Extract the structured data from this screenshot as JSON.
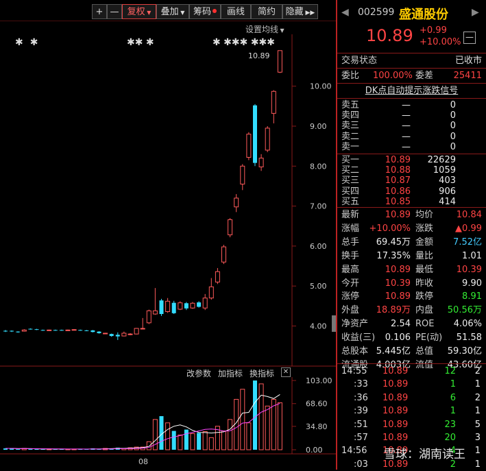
{
  "toolbar": {
    "plus": "+",
    "minus": "—",
    "fuquan": "复权",
    "diejia": "叠加",
    "chouma": "筹码",
    "huaxian": "画线",
    "jianyue": "简约",
    "yincang": "隐藏"
  },
  "chart": {
    "set_ma": "设置均线",
    "high_label": "10.89",
    "y_ticks": [
      "10.00",
      "9.00",
      "8.00",
      "7.00",
      "6.00",
      "5.00",
      "4.00"
    ],
    "date_label": "08",
    "indicator_buttons": [
      "改参数",
      "加指标",
      "换指标"
    ],
    "vol_ticks": [
      "103.00",
      "68.60",
      "34.80",
      "0.00"
    ]
  },
  "chart_data": {
    "type": "candlestick",
    "price_ticks": [
      10,
      9,
      8,
      7,
      6,
      5,
      4
    ],
    "candles": [
      {
        "o": 3.88,
        "c": 3.87,
        "h": 3.9,
        "l": 3.85
      },
      {
        "o": 3.88,
        "c": 3.87,
        "h": 3.89,
        "l": 3.85
      },
      {
        "o": 3.86,
        "c": 3.85,
        "h": 3.87,
        "l": 3.83
      },
      {
        "o": 3.87,
        "c": 3.9,
        "h": 3.92,
        "l": 3.86
      },
      {
        "o": 3.93,
        "c": 3.92,
        "h": 3.94,
        "l": 3.91
      },
      {
        "o": 3.92,
        "c": 3.91,
        "h": 3.93,
        "l": 3.9
      },
      {
        "o": 3.9,
        "c": 3.89,
        "h": 3.91,
        "l": 3.88
      },
      {
        "o": 3.89,
        "c": 3.9,
        "h": 3.91,
        "l": 3.88
      },
      {
        "o": 3.9,
        "c": 3.89,
        "h": 3.91,
        "l": 3.88
      },
      {
        "o": 3.9,
        "c": 3.89,
        "h": 3.91,
        "l": 3.88
      },
      {
        "o": 3.89,
        "c": 3.9,
        "h": 3.91,
        "l": 3.88
      },
      {
        "o": 3.9,
        "c": 3.91,
        "h": 3.92,
        "l": 3.89
      },
      {
        "o": 3.9,
        "c": 3.89,
        "h": 3.91,
        "l": 3.88
      },
      {
        "o": 3.89,
        "c": 3.88,
        "h": 3.9,
        "l": 3.87
      },
      {
        "o": 3.89,
        "c": 3.85,
        "h": 3.9,
        "l": 3.84
      },
      {
        "o": 3.86,
        "c": 3.82,
        "h": 3.87,
        "l": 3.81
      },
      {
        "o": 3.82,
        "c": 3.82,
        "h": 3.83,
        "l": 3.8
      },
      {
        "o": 3.8,
        "c": 3.75,
        "h": 3.81,
        "l": 3.73
      },
      {
        "o": 3.78,
        "c": 3.74,
        "h": 3.84,
        "l": 3.65
      },
      {
        "o": 3.75,
        "c": 3.82,
        "h": 3.86,
        "l": 3.74
      },
      {
        "o": 3.8,
        "c": 3.8,
        "h": 3.82,
        "l": 3.77
      },
      {
        "o": 3.8,
        "c": 3.94,
        "h": 3.95,
        "l": 3.79
      },
      {
        "o": 3.93,
        "c": 3.94,
        "h": 4.2,
        "l": 3.92
      },
      {
        "o": 4.08,
        "c": 4.38,
        "h": 4.41,
        "l": 4.05
      },
      {
        "o": 4.3,
        "c": 4.38,
        "h": 4.95,
        "l": 4.28
      },
      {
        "o": 4.64,
        "c": 4.3,
        "h": 4.68,
        "l": 4.25
      },
      {
        "o": 4.36,
        "c": 4.62,
        "h": 4.7,
        "l": 4.33
      },
      {
        "o": 4.58,
        "c": 4.32,
        "h": 4.63,
        "l": 4.3
      },
      {
        "o": 4.42,
        "c": 4.58,
        "h": 4.62,
        "l": 4.4
      },
      {
        "o": 4.57,
        "c": 4.44,
        "h": 4.6,
        "l": 4.4
      },
      {
        "o": 4.45,
        "c": 4.57,
        "h": 4.6,
        "l": 4.43
      },
      {
        "o": 4.59,
        "c": 4.48,
        "h": 4.62,
        "l": 4.46
      },
      {
        "o": 4.45,
        "c": 4.7,
        "h": 4.8,
        "l": 4.4
      },
      {
        "o": 4.7,
        "c": 4.98,
        "h": 5.2,
        "l": 4.66
      },
      {
        "o": 5.1,
        "c": 5.36,
        "h": 5.45,
        "l": 5.05
      },
      {
        "o": 5.6,
        "c": 5.98,
        "h": 6.03,
        "l": 5.55
      },
      {
        "o": 6.28,
        "c": 6.66,
        "h": 6.7,
        "l": 6.22
      },
      {
        "o": 6.98,
        "c": 7.2,
        "h": 7.3,
        "l": 6.85
      },
      {
        "o": 7.55,
        "c": 8.0,
        "h": 8.05,
        "l": 7.4
      },
      {
        "o": 8.22,
        "c": 8.8,
        "h": 8.85,
        "l": 8.15
      },
      {
        "o": 9.52,
        "c": 8.08,
        "h": 9.55,
        "l": 8.0
      },
      {
        "o": 7.98,
        "c": 8.2,
        "h": 8.3,
        "l": 7.88
      },
      {
        "o": 8.4,
        "c": 8.95,
        "h": 9.0,
        "l": 8.35
      },
      {
        "o": 9.32,
        "c": 9.87,
        "h": 9.9,
        "l": 9.07
      },
      {
        "o": 10.35,
        "c": 10.89,
        "h": 10.89,
        "l": 10.33
      }
    ],
    "volumes": [
      2,
      2,
      1,
      2,
      1,
      1,
      1,
      1,
      1,
      1,
      1,
      1,
      1,
      1,
      2,
      1,
      2,
      2,
      3,
      2,
      3,
      4,
      4,
      12,
      45,
      50,
      40,
      28,
      22,
      30,
      24,
      25,
      27,
      18,
      35,
      28,
      45,
      75,
      90,
      40,
      103,
      98,
      65,
      75,
      70
    ],
    "vol_ticks": [
      103,
      68.6,
      34.8,
      0
    ]
  },
  "stock": {
    "code": "002599",
    "name": "盛通股份",
    "price": "10.89",
    "change": "+0.99",
    "change_pct": "+10.00%",
    "status_label": "交易状态",
    "status_value": "已收市",
    "weibi_label": "委比",
    "weibi_value": "100.00%",
    "weicha_label": "委差",
    "weicha_value": "25411",
    "dk_signal": "DK点自动提示涨跌信号"
  },
  "order_book": {
    "asks": [
      {
        "label": "卖五",
        "price": "—",
        "vol": "0"
      },
      {
        "label": "卖四",
        "price": "—",
        "vol": "0"
      },
      {
        "label": "卖三",
        "price": "—",
        "vol": "0"
      },
      {
        "label": "卖二",
        "price": "—",
        "vol": "0"
      },
      {
        "label": "卖一",
        "price": "—",
        "vol": "0"
      }
    ],
    "bids": [
      {
        "label": "买一",
        "price": "10.89",
        "vol": "22629"
      },
      {
        "label": "买二",
        "price": "10.88",
        "vol": "1059"
      },
      {
        "label": "买三",
        "price": "10.87",
        "vol": "403"
      },
      {
        "label": "买四",
        "price": "10.86",
        "vol": "906"
      },
      {
        "label": "买五",
        "price": "10.85",
        "vol": "414"
      }
    ]
  },
  "quote": [
    {
      "l1": "最新",
      "v1": "10.89",
      "c1": "red",
      "l2": "均价",
      "v2": "10.84",
      "c2": "red"
    },
    {
      "l1": "涨幅",
      "v1": "+10.00%",
      "c1": "red",
      "l2": "涨跌",
      "v2": "▲0.99",
      "c2": "red"
    },
    {
      "l1": "总手",
      "v1": "69.45万",
      "c1": "white",
      "l2": "金额",
      "v2": "7.52亿",
      "c2": "cyan"
    },
    {
      "l1": "换手",
      "v1": "17.35%",
      "c1": "white",
      "l2": "量比",
      "v2": "1.01",
      "c2": "white"
    },
    {
      "l1": "最高",
      "v1": "10.89",
      "c1": "red",
      "l2": "最低",
      "v2": "10.39",
      "c2": "red"
    },
    {
      "l1": "今开",
      "v1": "10.39",
      "c1": "red",
      "l2": "昨收",
      "v2": "9.90",
      "c2": "white"
    },
    {
      "l1": "涨停",
      "v1": "10.89",
      "c1": "red",
      "l2": "跌停",
      "v2": "8.91",
      "c2": "green"
    },
    {
      "l1": "外盘",
      "v1": "18.89万",
      "c1": "red",
      "l2": "内盘",
      "v2": "50.56万",
      "c2": "green"
    },
    {
      "l1": "净资产",
      "v1": "2.54",
      "c1": "white",
      "l2": "ROE",
      "v2": "4.06%",
      "c2": "white"
    },
    {
      "l1": "收益(三)",
      "v1": "0.106",
      "c1": "white",
      "l2": "PE(动)",
      "v2": "51.58",
      "c2": "white"
    },
    {
      "l1": "总股本",
      "v1": "5.445亿",
      "c1": "white",
      "l2": "总值",
      "v2": "59.30亿",
      "c2": "white"
    },
    {
      "l1": "流通股",
      "v1": "4.003亿",
      "c1": "white",
      "l2": "流值",
      "v2": "43.60亿",
      "c2": "white"
    }
  ],
  "ticks": [
    {
      "time": "14:55",
      "price": "10.89",
      "vol": "12",
      "n": "2",
      "vc": "green"
    },
    {
      "time": ":33",
      "price": "10.89",
      "vol": "1",
      "n": "1",
      "vc": "green"
    },
    {
      "time": ":36",
      "price": "10.89",
      "vol": "6",
      "n": "2",
      "vc": "green"
    },
    {
      "time": ":39",
      "price": "10.89",
      "vol": "1",
      "n": "1",
      "vc": "green"
    },
    {
      "time": ":51",
      "price": "10.89",
      "vol": "23",
      "n": "5",
      "vc": "green"
    },
    {
      "time": ":57",
      "price": "10.89",
      "vol": "20",
      "n": "3",
      "vc": "green"
    },
    {
      "time": "14:56",
      "price": "10.89",
      "vol": "4",
      "n": "1",
      "vc": "green"
    },
    {
      "time": ":03",
      "price": "10.89",
      "vol": "2",
      "n": "1",
      "vc": "green"
    }
  ],
  "watermark": "雪球：湖南读王"
}
